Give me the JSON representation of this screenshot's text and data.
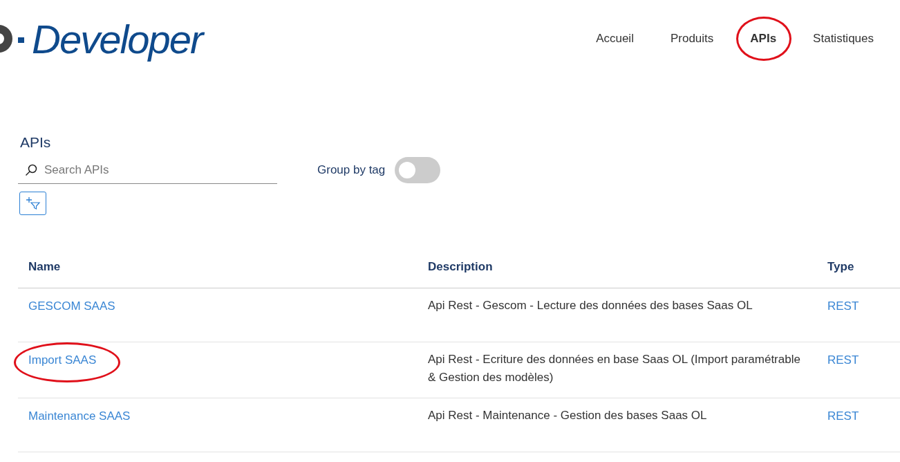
{
  "logo": {
    "text": "Developer"
  },
  "nav": [
    {
      "label": "Accueil",
      "selected": false,
      "circled": false
    },
    {
      "label": "Produits",
      "selected": false,
      "circled": false
    },
    {
      "label": "APIs",
      "selected": true,
      "circled": true
    },
    {
      "label": "Statistiques",
      "selected": false,
      "circled": false
    }
  ],
  "section_title": "APIs",
  "search": {
    "placeholder": "Search APIs"
  },
  "group_by_tag": {
    "label": "Group by tag",
    "on": false
  },
  "table": {
    "columns": [
      "Name",
      "Description",
      "Type"
    ],
    "rows": [
      {
        "name": "GESCOM SAAS",
        "description": "Api Rest - Gescom - Lecture des données des bases Saas OL",
        "type": "REST",
        "circled": false
      },
      {
        "name": "Import SAAS",
        "description": "Api Rest - Ecriture des données en base Saas OL (Import paramétrable & Gestion des modèles)",
        "type": "REST",
        "circled": true
      },
      {
        "name": "Maintenance SAAS",
        "description": "Api Rest - Maintenance - Gestion des bases Saas OL",
        "type": "REST",
        "circled": false
      }
    ]
  }
}
